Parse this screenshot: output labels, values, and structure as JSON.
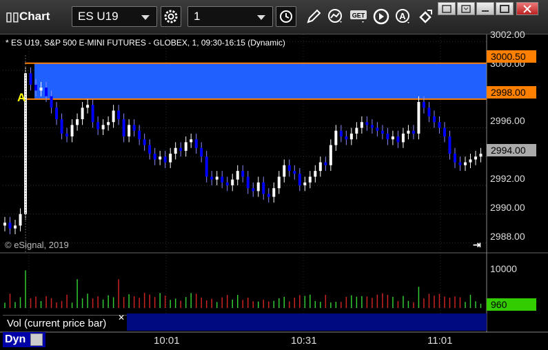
{
  "window": {
    "title": "Chart"
  },
  "toolbar": {
    "symbol": "ES U19",
    "interval": "1"
  },
  "chart": {
    "header": "* ES U19, S&P 500 E-MINI FUTURES - GLOBEX, 1, 09:30-16:15 (Dynamic)",
    "copyright": "© eSignal, 2019",
    "marker": "A",
    "price_axis": [
      "3002.00",
      "3000.00",
      "2996.00",
      "2992.00",
      "2990.00",
      "2988.00"
    ],
    "price_tags": {
      "upper": "3000.50",
      "lower": "2998.00",
      "last": "2994.00",
      "volume_last": "960"
    },
    "volume_axis": [
      "10000"
    ],
    "volume_label": "Vol (current price bar)",
    "dyn_label": "Dyn",
    "time_axis": [
      "10:01",
      "10:31",
      "11:01"
    ]
  },
  "colors": {
    "zone_fill": "#2060ff",
    "zone_line": "#ff8000",
    "up_candle": "#ffffff",
    "down_candle": "#0000ff",
    "vol_up": "#33cc33",
    "vol_down": "#cc2222"
  },
  "chart_data": {
    "type": "candlestick",
    "ylim": [
      2987.3,
      3002.5
    ],
    "zone": [
      2998.0,
      3000.5
    ],
    "last_price": 2994.0,
    "close_series": [
      2989.4,
      2989.0,
      2989.2,
      2990.0,
      2999.8,
      2999.0,
      2998.6,
      2998.8,
      2998.2,
      2997.4,
      2996.6,
      2995.6,
      2995.4,
      2996.2,
      2996.6,
      2997.4,
      2997.6,
      2996.4,
      2995.9,
      2996.2,
      2996.4,
      2997.2,
      2996.6,
      2995.4,
      2996.2,
      2995.8,
      2995.2,
      2994.8,
      2994.2,
      2993.8,
      2994.0,
      2993.6,
      2994.2,
      2994.6,
      2994.4,
      2995.0,
      2995.2,
      2994.6,
      2994.0,
      2992.6,
      2992.4,
      2992.6,
      2992.2,
      2992.0,
      2992.4,
      2993.0,
      2992.6,
      2991.8,
      2991.6,
      2992.2,
      2991.4,
      2991.2,
      2991.8,
      2992.6,
      2993.4,
      2993.0,
      2992.8,
      2992.0,
      2992.2,
      2992.6,
      2993.0,
      2993.6,
      2993.4,
      2994.8,
      2995.8,
      2995.4,
      2995.2,
      2995.6,
      2996.0,
      2996.4,
      2996.2,
      2996.0,
      2995.8,
      2995.6,
      2995.2,
      2995.4,
      2995.0,
      2995.6,
      2995.8,
      2995.6,
      2997.8,
      2997.4,
      2996.8,
      2996.4,
      2996.0,
      2995.4,
      2994.2,
      2993.6,
      2993.4,
      2993.6,
      2993.8,
      2994.0,
      2994.2
    ],
    "volume_units": "contracts",
    "volume_ylim": [
      0,
      12000
    ]
  }
}
